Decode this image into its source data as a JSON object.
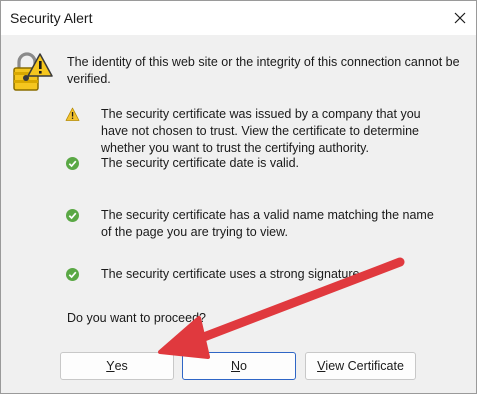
{
  "dialog": {
    "title": "Security Alert",
    "icons": {
      "close": "close-icon",
      "lock": "lock-warning-icon",
      "warning": "warning-icon",
      "ok": "check-circle-icon"
    },
    "intro": "The identity of this web site or the integrity of this connection cannot be verified.",
    "items": [
      {
        "status": "warning",
        "lines": [
          "The security certificate was issued by a company that you",
          "have not chosen to trust. View the certificate to determine",
          "whether you want to trust the certifying authority."
        ]
      },
      {
        "status": "ok",
        "lines": [
          "The security certificate date is valid."
        ]
      },
      {
        "status": "ok",
        "lines": [
          "The security certificate has a valid name matching the name",
          "of the page you are trying to view."
        ]
      },
      {
        "status": "ok",
        "lines": [
          "The security certificate uses a strong signature."
        ]
      }
    ],
    "question": "Do you want to proceed?",
    "buttons": {
      "yes": {
        "accel": "Y",
        "rest": "es"
      },
      "no": {
        "accel": "N",
        "rest": "o"
      },
      "view": {
        "accel": "V",
        "rest": "iew Certificate"
      }
    }
  },
  "colors": {
    "accent": "#2f66c6",
    "annotation_arrow": "#e0393e",
    "ok_green": "#5aa845",
    "warning_yellow": "#f2c230"
  }
}
